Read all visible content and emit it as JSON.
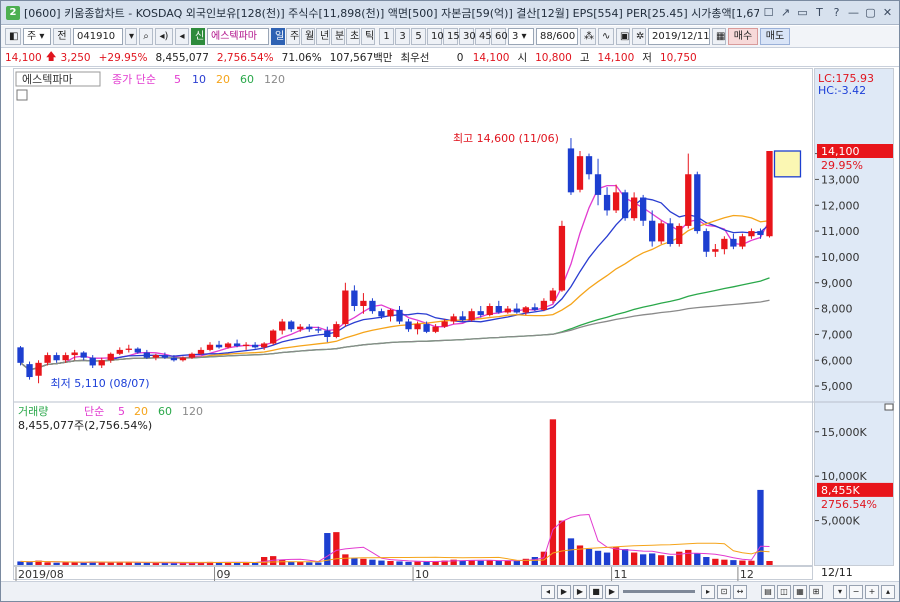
{
  "window": {
    "badge": "2",
    "title": "[0600] 키움종합차트 - KOSDAQ 외국인보유[128(천)] 주식수[11,898(천)] 액면[500] 자본금[59(억)] 결산[12월] EPS[554] PER[25.45] 시가총액[1,67",
    "buttons": [
      "☐",
      "↗",
      "▭",
      "T",
      "?",
      "—",
      "▢",
      "✕"
    ]
  },
  "toolbar": {
    "period_select": "주",
    "market_label": "전",
    "code": "041910",
    "kind": "신",
    "stock_name": "에스텍파마",
    "period_buttons": [
      "일",
      "주",
      "월",
      "년",
      "분",
      "초",
      "틱"
    ],
    "active_period": "일",
    "intervals": [
      "1",
      "3",
      "5",
      "10",
      "15",
      "30",
      "45",
      "60"
    ],
    "interval_value": "3",
    "count": "88",
    "count_total": "/600",
    "date": "2019/12/11",
    "buy": "매수",
    "sell": "매도"
  },
  "quote": {
    "price": "14,100",
    "change": "3,250",
    "change_pct": "+29.95%",
    "volume": "8,455,077",
    "volume_ratio": "2,756.54%",
    "turnover": "71.06%",
    "amount": "107,567백만",
    "priority_label": "최우선",
    "priority_value": "0",
    "current": "14,100",
    "open_label": "시",
    "open": "10,800",
    "high_label": "고",
    "high": "14,100",
    "low_label": "저",
    "low": "10,750"
  },
  "chart_data": [
    {
      "type": "candlestick",
      "title": "에스텍파마",
      "legend": {
        "label": "종가 단순",
        "periods": [
          "5",
          "10",
          "20",
          "60",
          "120"
        ]
      },
      "ylim": [
        4500,
        16500
      ],
      "yticks": [
        5000,
        6000,
        7000,
        8000,
        9000,
        10000,
        11000,
        12000,
        13000,
        14000
      ],
      "x_labels": [
        "2019/08",
        "09",
        "10",
        "11",
        "12"
      ],
      "x_end_label": "12/11",
      "annotations": {
        "high": "최고 14,600 (11/06)",
        "low": "최저 5,110 (08/07)",
        "lc": "LC:175.93",
        "hc": "HC:-3.42",
        "last_price": "14,100",
        "last_pct": "29.95%"
      },
      "candles": [
        [
          6500,
          6550,
          5800,
          5900
        ],
        [
          5850,
          5950,
          5250,
          5350
        ],
        [
          5400,
          6000,
          5110,
          5900
        ],
        [
          5900,
          6300,
          5800,
          6200
        ],
        [
          6200,
          6300,
          5900,
          6000
        ],
        [
          6000,
          6300,
          5900,
          6200
        ],
        [
          6200,
          6400,
          6000,
          6300
        ],
        [
          6300,
          6350,
          6000,
          6100
        ],
        [
          6100,
          6200,
          5700,
          5800
        ],
        [
          5800,
          6100,
          5700,
          6000
        ],
        [
          6000,
          6300,
          5900,
          6250
        ],
        [
          6250,
          6500,
          6200,
          6400
        ],
        [
          6400,
          6600,
          6300,
          6450
        ],
        [
          6450,
          6500,
          6250,
          6300
        ],
        [
          6300,
          6400,
          6050,
          6100
        ],
        [
          6100,
          6250,
          6000,
          6200
        ],
        [
          6200,
          6300,
          6050,
          6100
        ],
        [
          6100,
          6200,
          5950,
          6000
        ],
        [
          6000,
          6150,
          5950,
          6100
        ],
        [
          6100,
          6300,
          6050,
          6250
        ],
        [
          6250,
          6500,
          6200,
          6400
        ],
        [
          6400,
          6700,
          6350,
          6600
        ],
        [
          6600,
          6750,
          6450,
          6500
        ],
        [
          6500,
          6700,
          6450,
          6650
        ],
        [
          6650,
          6800,
          6500,
          6550
        ],
        [
          6550,
          6700,
          6400,
          6600
        ],
        [
          6600,
          6700,
          6450,
          6500
        ],
        [
          6500,
          6700,
          6400,
          6650
        ],
        [
          6650,
          7200,
          6600,
          7150
        ],
        [
          7150,
          7600,
          7000,
          7500
        ],
        [
          7500,
          7550,
          7100,
          7200
        ],
        [
          7200,
          7400,
          7100,
          7300
        ],
        [
          7300,
          7400,
          7100,
          7200
        ],
        [
          7200,
          7300,
          7050,
          7150
        ],
        [
          7150,
          7300,
          6700,
          6900
        ],
        [
          6900,
          7500,
          6850,
          7400
        ],
        [
          7400,
          9000,
          7300,
          8700
        ],
        [
          8700,
          8900,
          7900,
          8100
        ],
        [
          8100,
          8600,
          7800,
          8300
        ],
        [
          8300,
          8400,
          7800,
          7900
        ],
        [
          7900,
          8000,
          7600,
          7700
        ],
        [
          7700,
          8000,
          7500,
          7950
        ],
        [
          7950,
          8100,
          7400,
          7500
        ],
        [
          7500,
          7600,
          7100,
          7200
        ],
        [
          7200,
          7500,
          7000,
          7400
        ],
        [
          7400,
          7500,
          7050,
          7100
        ],
        [
          7100,
          7400,
          7050,
          7300
        ],
        [
          7300,
          7600,
          7250,
          7500
        ],
        [
          7500,
          7800,
          7400,
          7700
        ],
        [
          7700,
          7900,
          7500,
          7550
        ],
        [
          7550,
          8000,
          7500,
          7900
        ],
        [
          7900,
          8100,
          7650,
          7750
        ],
        [
          7750,
          8200,
          7700,
          8100
        ],
        [
          8100,
          8300,
          7800,
          7850
        ],
        [
          7850,
          8100,
          7800,
          8000
        ],
        [
          8000,
          8200,
          7800,
          7850
        ],
        [
          7850,
          8100,
          7750,
          8050
        ],
        [
          8050,
          8200,
          7900,
          7950
        ],
        [
          7950,
          8400,
          7900,
          8300
        ],
        [
          8300,
          8800,
          8200,
          8700
        ],
        [
          8700,
          11400,
          8650,
          11200
        ],
        [
          14200,
          14600,
          12400,
          12500
        ],
        [
          12600,
          14100,
          12500,
          13900
        ],
        [
          13900,
          14000,
          13000,
          13200
        ],
        [
          13200,
          13800,
          12000,
          12400
        ],
        [
          12400,
          12700,
          11600,
          11800
        ],
        [
          11800,
          12800,
          11700,
          12500
        ],
        [
          12500,
          12600,
          11400,
          11500
        ],
        [
          11500,
          12500,
          11400,
          12300
        ],
        [
          12300,
          12400,
          11200,
          11400
        ],
        [
          11400,
          11800,
          10400,
          10600
        ],
        [
          10600,
          11400,
          10500,
          11300
        ],
        [
          11300,
          11500,
          10400,
          10500
        ],
        [
          10500,
          11300,
          10400,
          11200
        ],
        [
          11200,
          14000,
          11100,
          13200
        ],
        [
          13200,
          13300,
          10900,
          11000
        ],
        [
          11000,
          11100,
          10000,
          10200
        ],
        [
          10200,
          10500,
          10000,
          10300
        ],
        [
          10300,
          10800,
          10100,
          10700
        ],
        [
          10700,
          10900,
          10300,
          10400
        ],
        [
          10400,
          10900,
          10300,
          10800
        ],
        [
          10800,
          11100,
          10700,
          11000
        ],
        [
          11000,
          11100,
          10700,
          10850
        ],
        [
          10800,
          14100,
          10750,
          14100
        ]
      ]
    },
    {
      "type": "bar",
      "title": "거래량",
      "legend": {
        "label": "단순",
        "periods": [
          "5",
          "20",
          "60",
          "120"
        ]
      },
      "summary": "8,455,077주(2,756.54%)",
      "ylim": [
        0,
        17000
      ],
      "yticks": [
        "5,000K",
        "10,000K",
        "15,000K"
      ],
      "last_value": "8,455K",
      "last_pct": "2756.54%",
      "values": [
        400,
        350,
        500,
        300,
        250,
        300,
        280,
        260,
        400,
        300,
        280,
        350,
        300,
        260,
        240,
        220,
        230,
        210,
        220,
        260,
        300,
        350,
        320,
        300,
        280,
        260,
        250,
        900,
        1000,
        600,
        400,
        350,
        300,
        280,
        3600,
        3700,
        1200,
        800,
        700,
        600,
        500,
        450,
        400,
        350,
        380,
        400,
        450,
        500,
        600,
        500,
        550,
        480,
        520,
        450,
        500,
        480,
        700,
        900,
        1500,
        16400,
        5000,
        3000,
        2200,
        1800,
        1600,
        1400,
        2000,
        1800,
        1400,
        1200,
        1300,
        1100,
        1000,
        1500,
        1700,
        1300,
        900,
        700,
        600,
        550,
        500,
        480,
        8455,
        450
      ]
    }
  ],
  "colors": {
    "up": "#e8151b",
    "down": "#1d3fd0",
    "ma5": "#e23bd0",
    "ma10": "#2a3dd1",
    "ma20": "#f5a41a",
    "ma60": "#2aa84a",
    "ma120": "#8a8a8a"
  }
}
